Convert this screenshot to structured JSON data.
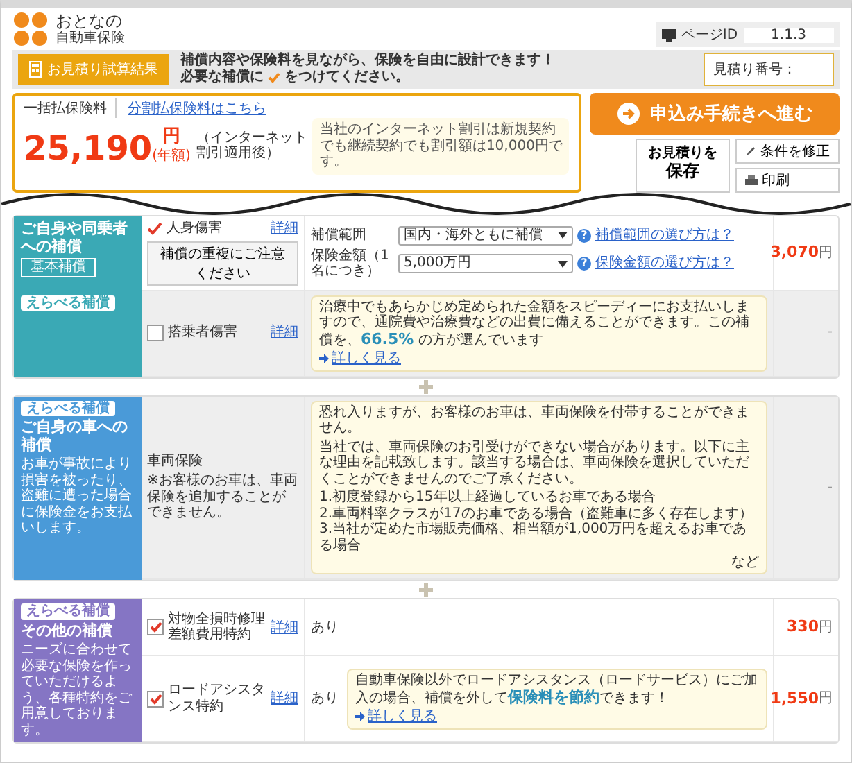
{
  "header": {
    "logo_line1": "おとなの",
    "logo_line2": "自動車保険",
    "page_id_label": "ページID",
    "page_id": "1.1.3"
  },
  "banner": {
    "tab": "お見積り試算結果",
    "line1": "補償内容や保険料を見ながら、保険を自由に設計できます！",
    "line2_before": "必要な補償に",
    "line2_after": "をつけてください。",
    "estimate_label": "見積り番号："
  },
  "premium": {
    "label": "一括払保険料",
    "installment_link": "分割払保険料はこちら",
    "amount": "25,190",
    "unit": "円",
    "period": "(年額)",
    "discount_note": "（インターネット割引適用後）",
    "bubble": "当社のインターネット割引は新規契約でも継続契約でも割引額は10,000円です。"
  },
  "actions": {
    "apply": "申込み手続きへ進む",
    "save_line1": "お見積りを",
    "save_line2": "保存",
    "modify": "条件を修正",
    "print": "印刷"
  },
  "sections": [
    {
      "color": "#3aa9b5",
      "rows": [
        {
          "kind": "settings",
          "side": {
            "title": "ご自身や同乗者への補償",
            "tag": "基本補償"
          },
          "label": "人身傷害",
          "checked": true,
          "locked": true,
          "detail": "詳細",
          "button": "補償の重複にご注意ください",
          "settings": [
            {
              "label": "補償範囲",
              "value": "国内・海外ともに補償",
              "help_mark": "?",
              "help": "補償範囲の選び方は？"
            },
            {
              "label": "保険金額（1名につき）",
              "value": "5,000万円",
              "help_mark": "?",
              "help": "保険金額の選び方は？"
            }
          ],
          "price": "3,070",
          "unit": "円"
        },
        {
          "kind": "tip",
          "side": {
            "badge": "えらべる補償"
          },
          "label": "搭乗者傷害",
          "checked": false,
          "locked": false,
          "detail": "詳細",
          "tip": {
            "text": "治療中でもあらかじめ定められた金額をスピーディーにお支払いしますので、通院費や治療費などの出費に備えることができます。この補償を、**66.5%** の方が選んでいます",
            "link": "詳しく見る"
          },
          "price": "-"
        }
      ]
    },
    {
      "color": "#4a9ad8",
      "rows": [
        {
          "kind": "note",
          "side": {
            "badge": "えらべる補償",
            "title": "ご自身の車への補償",
            "description": "お車が事故により損害を被ったり、盗難に遭った場合に保険金をお支払いします。"
          },
          "label": "車両保険",
          "note": "※お客様のお車は、車両保険を追加することができません。",
          "tip": {
            "paragraphs": [
              "恐れ入りますが、お客様のお車は、車両保険を付帯することができません。",
              "当社では、車両保険のお引受けができない場合があります。以下に主な理由を記載致します。該当する場合は、車両保険を選択していただくことができませんのでご了承ください。",
              "1.初度登録から15年以上経過しているお車である場合\n2.車両料率クラスが17のお車である場合（盗難車に多く存在します）\n3.当社が定めた市場販売価格、相当額が1,000万円を超えるお車である場合"
            ],
            "trailing": "など"
          },
          "price": "-"
        }
      ]
    },
    {
      "color": "#8575c4",
      "rows": [
        {
          "kind": "value",
          "side": {
            "badge": "えらべる補償",
            "title": "その他の補償",
            "description": "ニーズに合わせて必要な保険を作っていただけるよう、各種特約をご用意しております。"
          },
          "label": "対物全損時修理差額費用特約",
          "checked": true,
          "locked": false,
          "detail": "詳細",
          "value": "あり",
          "price": "330",
          "unit": "円"
        },
        {
          "kind": "value",
          "label": "ロードアシスタンス特約",
          "checked": true,
          "locked": false,
          "detail": "詳細",
          "value": "あり",
          "tip": {
            "text": "自動車保険以外でロードアシスタンス（ロードサービス）にご加入の場合、補償を外して**保険料を節約**できます！",
            "link": "詳しく見る"
          },
          "price": "1,550",
          "unit": "円"
        }
      ]
    }
  ]
}
